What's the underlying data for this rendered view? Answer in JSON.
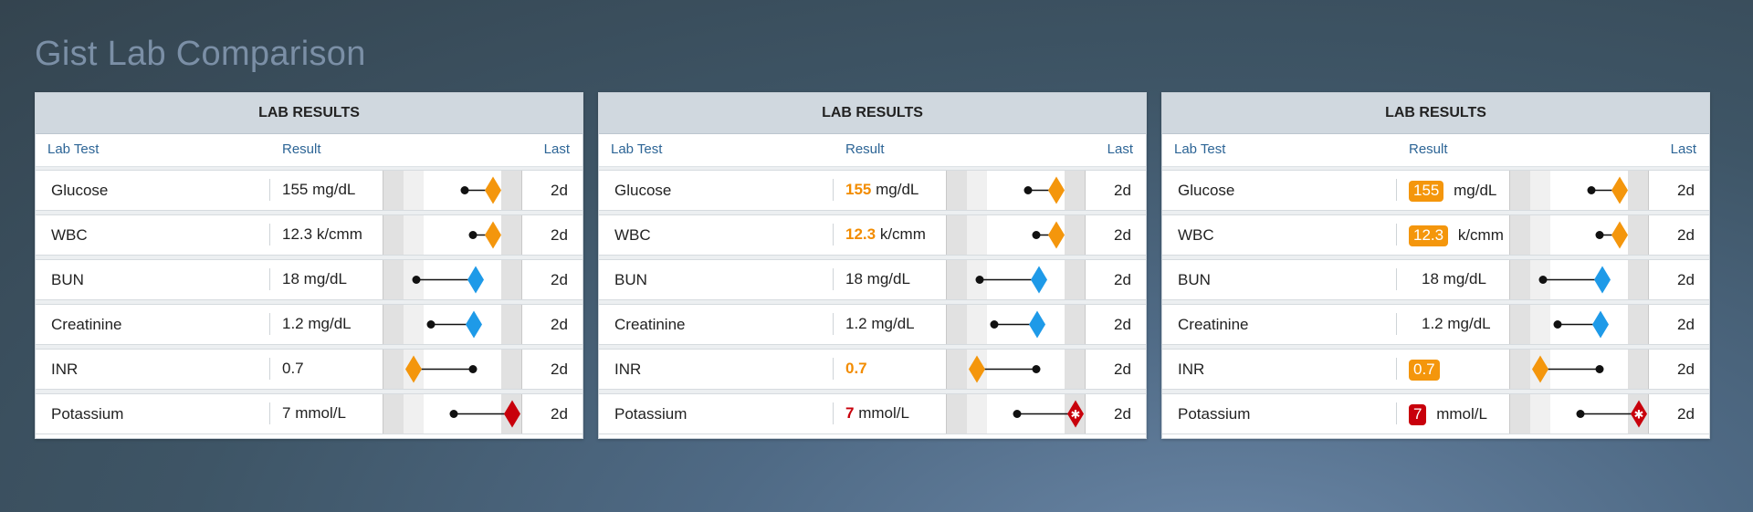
{
  "page_title": "Gist Lab Comparison",
  "colors": {
    "high": "#f4960c",
    "low": "#1e9ae8",
    "critical": "#c8000b"
  },
  "panels": [
    {
      "header": "LAB RESULTS",
      "columns": {
        "test": "Lab Test",
        "result": "Result",
        "last": "Last"
      },
      "style": "plain",
      "rows": [
        {
          "name": "Glucose",
          "value": "155",
          "unit": "mg/dL",
          "flag": "high",
          "last": "2d",
          "marker_icon": "orange-diamond-icon"
        },
        {
          "name": "WBC",
          "value": "12.3",
          "unit": "k/cmm",
          "flag": "high",
          "last": "2d",
          "marker_icon": "orange-diamond-icon"
        },
        {
          "name": "BUN",
          "value": "18",
          "unit": "mg/dL",
          "flag": "low",
          "last": "2d",
          "marker_icon": "blue-diamond-icon"
        },
        {
          "name": "Creatinine",
          "value": "1.2",
          "unit": "mg/dL",
          "flag": "low",
          "last": "2d",
          "marker_icon": "blue-diamond-icon"
        },
        {
          "name": "INR",
          "value": "0.7",
          "unit": "",
          "flag": "high",
          "last": "2d",
          "marker_icon": "orange-diamond-icon"
        },
        {
          "name": "Potassium",
          "value": "7",
          "unit": "mmol/L",
          "flag": "critical",
          "last": "2d",
          "marker_icon": "red-diamond-icon"
        }
      ]
    },
    {
      "header": "LAB RESULTS",
      "columns": {
        "test": "Lab Test",
        "result": "Result",
        "last": "Last"
      },
      "style": "colored",
      "rows": [
        {
          "name": "Glucose",
          "value": "155",
          "unit": "mg/dL",
          "flag": "high",
          "last": "2d",
          "marker_icon": "orange-diamond-icon"
        },
        {
          "name": "WBC",
          "value": "12.3",
          "unit": "k/cmm",
          "flag": "high",
          "last": "2d",
          "marker_icon": "orange-diamond-icon"
        },
        {
          "name": "BUN",
          "value": "18",
          "unit": "mg/dL",
          "flag": "low",
          "last": "2d",
          "marker_icon": "blue-diamond-icon"
        },
        {
          "name": "Creatinine",
          "value": "1.2",
          "unit": "mg/dL",
          "flag": "low",
          "last": "2d",
          "marker_icon": "blue-diamond-icon"
        },
        {
          "name": "INR",
          "value": "0.7",
          "unit": "",
          "flag": "high",
          "last": "2d",
          "marker_icon": "orange-diamond-icon"
        },
        {
          "name": "Potassium",
          "value": "7",
          "unit": "mmol/L",
          "flag": "critical",
          "last": "2d",
          "marker_icon": "red-diamond-star-icon"
        }
      ]
    },
    {
      "header": "LAB RESULTS",
      "columns": {
        "test": "Lab Test",
        "result": "Result",
        "last": "Last"
      },
      "style": "badge",
      "rows": [
        {
          "name": "Glucose",
          "value": "155",
          "unit": "mg/dL",
          "flag": "high",
          "last": "2d",
          "marker_icon": "orange-diamond-icon"
        },
        {
          "name": "WBC",
          "value": "12.3",
          "unit": "k/cmm",
          "flag": "high",
          "last": "2d",
          "marker_icon": "orange-diamond-icon"
        },
        {
          "name": "BUN",
          "value": "18",
          "unit": "mg/dL",
          "flag": "low",
          "last": "2d",
          "marker_icon": "blue-diamond-icon"
        },
        {
          "name": "Creatinine",
          "value": "1.2",
          "unit": "mg/dL",
          "flag": "low",
          "last": "2d",
          "marker_icon": "blue-diamond-icon"
        },
        {
          "name": "INR",
          "value": "0.7",
          "unit": "",
          "flag": "high",
          "last": "2d",
          "marker_icon": "orange-diamond-icon"
        },
        {
          "name": "Potassium",
          "value": "7",
          "unit": "mmol/L",
          "flag": "critical",
          "last": "2d",
          "marker_icon": "red-diamond-star-icon"
        }
      ]
    }
  ]
}
